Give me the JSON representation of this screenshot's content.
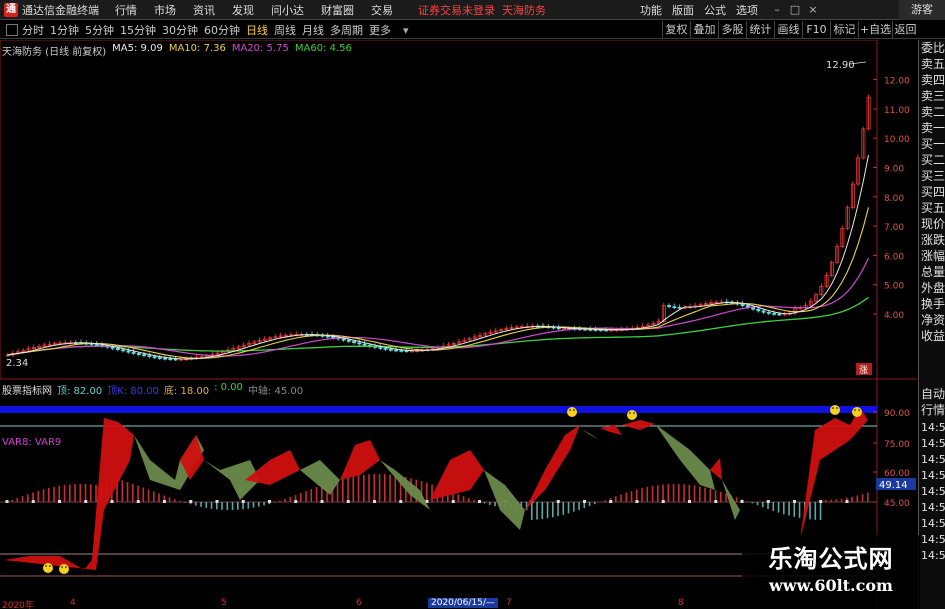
{
  "app": {
    "title": "通达信金融终端",
    "status_msg": "证券交易未登录",
    "stock_name": "天海防务",
    "login": "游客"
  },
  "menus": [
    "行情",
    "市场",
    "资讯",
    "发现",
    "问小达",
    "财富圈",
    "交易"
  ],
  "right_menus": [
    "功能",
    "版面",
    "公式",
    "选项"
  ],
  "periods": [
    {
      "label": "分时",
      "active": false
    },
    {
      "label": "1分钟",
      "active": false
    },
    {
      "label": "5分钟",
      "active": false
    },
    {
      "label": "15分钟",
      "active": false
    },
    {
      "label": "30分钟",
      "active": false
    },
    {
      "label": "60分钟",
      "active": false
    },
    {
      "label": "日线",
      "active": true
    },
    {
      "label": "周线",
      "active": false
    },
    {
      "label": "月线",
      "active": false
    },
    {
      "label": "多周期",
      "active": false
    },
    {
      "label": "更多",
      "active": false
    }
  ],
  "toolbar_right": [
    "复权",
    "叠加",
    "多股",
    "统计",
    "画线",
    "F10",
    "标记",
    "+自选",
    "返回"
  ],
  "info": {
    "stock": "天海防务 (日线 前复权)",
    "ma5": "MA5: 9.09",
    "ma10": "MA10: 7.36",
    "ma20": "MA20: 5.75",
    "ma60": "MA60: 4.56"
  },
  "colors": {
    "ma5": "#e8e8e8",
    "ma10": "#e6d24a",
    "ma20": "#d04ad0",
    "ma60": "#3fd03f",
    "up": "#ff3c3c",
    "down": "#5fe0e0"
  },
  "price_axis": [
    "12.00",
    "11.00",
    "10.00",
    "9.00",
    "8.00",
    "7.00",
    "6.00",
    "5.00",
    "4.00"
  ],
  "high_label": "12.90",
  "low_label": "2.34",
  "ind_axis": [
    "90.00",
    "75.00",
    "60.00",
    "45.00"
  ],
  "ind_value_tag": "49.14",
  "indicator": {
    "name": "股票指标网",
    "top": "顶: 82.00",
    "mid": "顶K: 80.00",
    "bottom": "底: 18.00",
    "zero": ": 0.00",
    "center": "中轴: 45.00"
  },
  "var_label": "VAR8: VAR9",
  "side_panel": [
    "委比",
    "卖五",
    "卖四",
    "卖三",
    "卖二",
    "卖一",
    "买一",
    "买二",
    "买三",
    "买四",
    "买五",
    "现价",
    "涨跌",
    "涨幅",
    "总量",
    "外盘",
    "换手",
    "净资",
    "收益"
  ],
  "side_tabs": [
    "自动",
    "行情"
  ],
  "side_times": [
    "14:50",
    "14:50",
    "14:50",
    "14:50",
    "14:50",
    "14:50",
    "14:50",
    "14:50",
    "14:50"
  ],
  "zhang_tag": "涨",
  "dates": {
    "start": "2020年",
    "m4": "4",
    "m5": "5",
    "m6": "6",
    "selected": "2020/06/15/—",
    "m7": "7",
    "m8": "8"
  },
  "watermark": {
    "cn": "乐淘公式网",
    "url": "www.60lt.com"
  }
}
